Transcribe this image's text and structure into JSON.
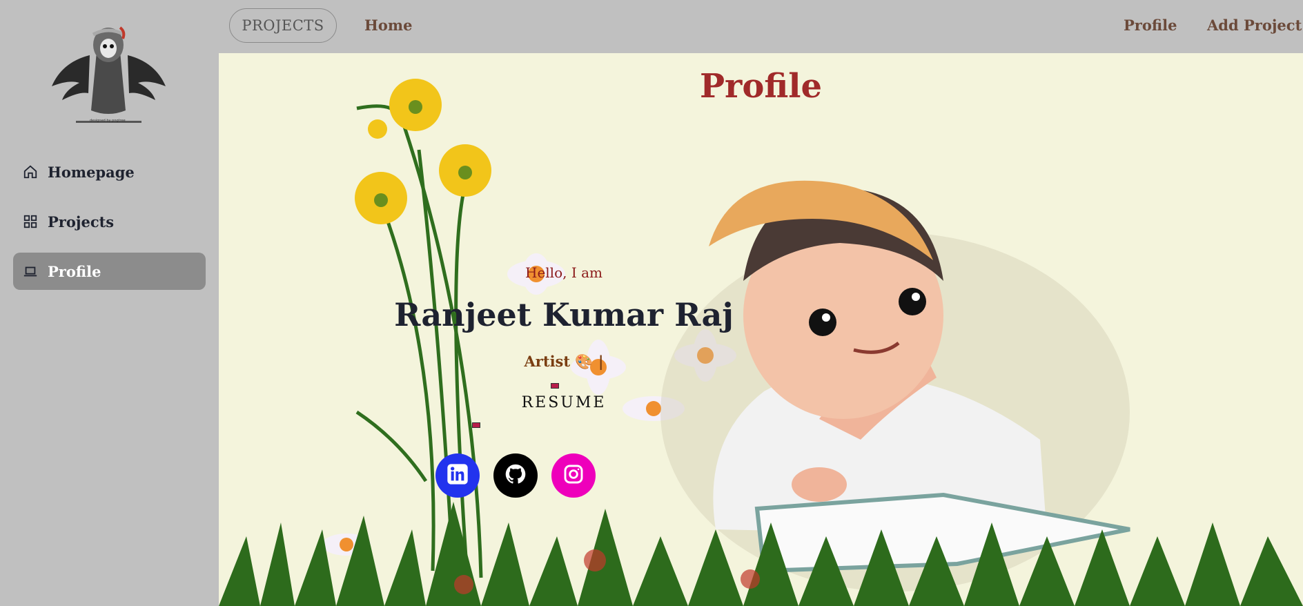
{
  "sidebar": {
    "logo_caption": "designed by pngtree",
    "items": [
      {
        "label": "Homepage",
        "icon": "home-icon"
      },
      {
        "label": "Projects",
        "icon": "grid-icon"
      },
      {
        "label": "Profile",
        "icon": "laptop-icon",
        "active": true
      }
    ]
  },
  "topbar": {
    "pill_label": "PROJECTS",
    "home_link": "Home",
    "profile_link": "Profile",
    "add_project_link": "Add Project"
  },
  "main": {
    "title": "Profile",
    "greeting": "Hello, I am",
    "name": "Ranjeet Kumar Raj",
    "role": "Artist 🎨 |",
    "resume": "RESUME",
    "social": [
      {
        "name": "linkedin",
        "icon": "linkedin-icon",
        "color": "#2233ee"
      },
      {
        "name": "github",
        "icon": "github-icon",
        "color": "#000000"
      },
      {
        "name": "instagram",
        "icon": "instagram-icon",
        "color": "#ee00bb"
      }
    ]
  },
  "colors": {
    "sidebar_bg": "#c0c0c0",
    "main_bg": "#f4f4dc",
    "title": "#a02a2a",
    "active_nav": "#8c8c8c"
  }
}
